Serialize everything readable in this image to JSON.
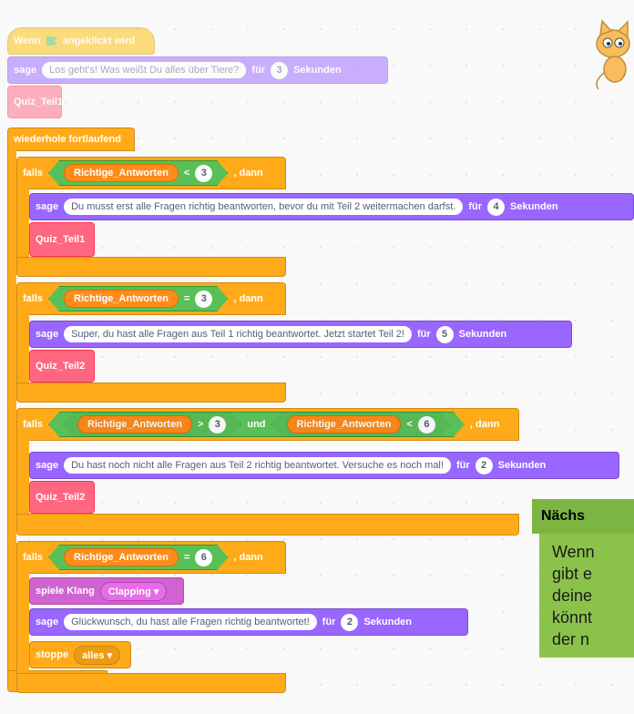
{
  "hat": {
    "when": "Wenn",
    "clicked": "angeklickt wird"
  },
  "intro_say": {
    "sage": "sage",
    "text": "Los geht's! Was weißt Du alles über Tiere?",
    "fuer": "für",
    "secs": "3",
    "sekunden": "Sekunden"
  },
  "intro_call": "Quiz_Teil1",
  "forever": "wiederhole fortlaufend",
  "blocks": {
    "falls": "falls",
    "dann": ", dann",
    "var": "Richtige_Antworten",
    "und": "und",
    "sage": "sage",
    "fuer": "für",
    "sekunden": "Sekunden"
  },
  "if1": {
    "op": "<",
    "val": "3",
    "say_text": "Du musst erst alle Fragen richtig beantworten, bevor du mit Teil 2 weitermachen darfst.",
    "secs": "4",
    "call": "Quiz_Teil1"
  },
  "if2": {
    "op": "=",
    "val": "3",
    "say_text": "Super, du hast alle Fragen aus Teil 1 richtig beantwortet. Jetzt startet Teil 2!",
    "secs": "5",
    "call": "Quiz_Teil2"
  },
  "if3": {
    "op_a": ">",
    "val_a": "3",
    "op_b": "<",
    "val_b": "6",
    "say_text": "Du hast noch nicht alle Fragen aus Teil 2 richtig beantwortet. Versuche es noch mal!",
    "secs": "2",
    "call": "Quiz_Teil2"
  },
  "if4": {
    "op": "=",
    "val": "6",
    "sound_label": "spiele Klang",
    "sound": "Clapping",
    "say_text": "Glückwunsch, du hast alle Fragen richtig beantwortet!",
    "secs": "2",
    "stop_label": "stoppe",
    "stop_value": "alles"
  },
  "panel": {
    "title": "Nächs",
    "lines": [
      "Wenn",
      "gibt e",
      "deine",
      "könnt",
      "der n"
    ]
  },
  "icons": {
    "flag": "green-flag-icon",
    "loop": "loop-arrow-icon",
    "sprite": "cat-sprite-icon",
    "dropdown": "caret-down-icon"
  }
}
